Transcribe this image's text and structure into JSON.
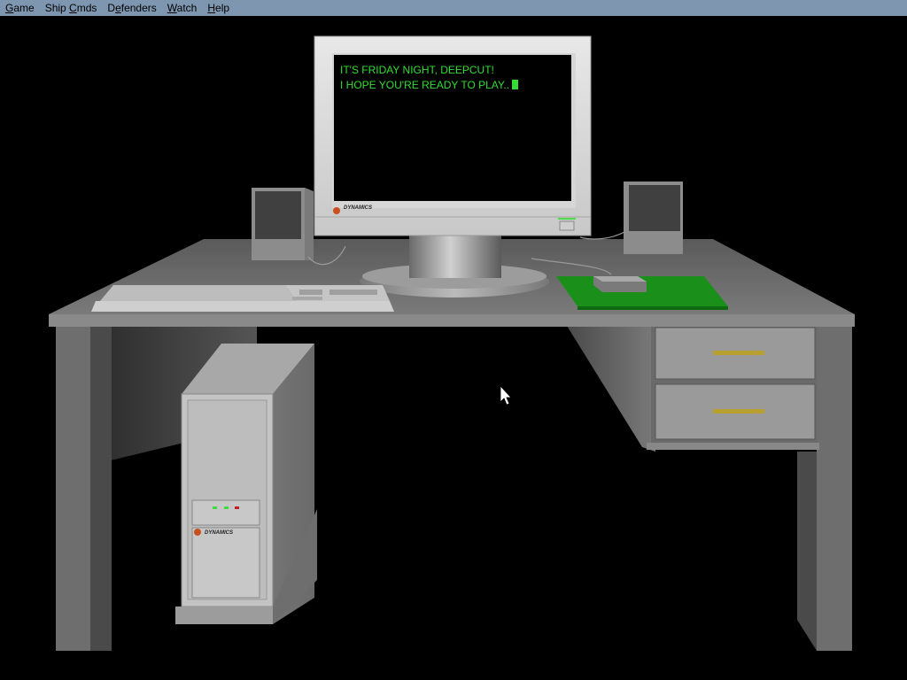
{
  "menubar": {
    "items": [
      {
        "label": "Game",
        "mnemonic": "G",
        "rest": "ame"
      },
      {
        "label": "Ship Cmds",
        "mnemonic": "",
        "pre": "Ship ",
        "mn": "C",
        "rest": "mds"
      },
      {
        "label": "Defenders",
        "mnemonic": "",
        "pre": "",
        "mn": "",
        "rest": "Defenders"
      },
      {
        "label": "Watch",
        "mnemonic": "W",
        "rest": "atch"
      },
      {
        "label": "Help",
        "mnemonic": "H",
        "rest": "elp"
      }
    ]
  },
  "monitor": {
    "screen_lines": [
      "IT'S FRIDAY NIGHT, DEEPCUT!",
      "I HOPE YOU'RE READY TO PLAY.."
    ],
    "text_color": "#33dd33"
  },
  "brand": {
    "name": "DYNAMICS"
  },
  "colors": {
    "menubar": "#7e96b0",
    "desk": "#6e6e6e",
    "mousepad": "#1a8f1a",
    "drawer_handle": "#b8a030"
  }
}
